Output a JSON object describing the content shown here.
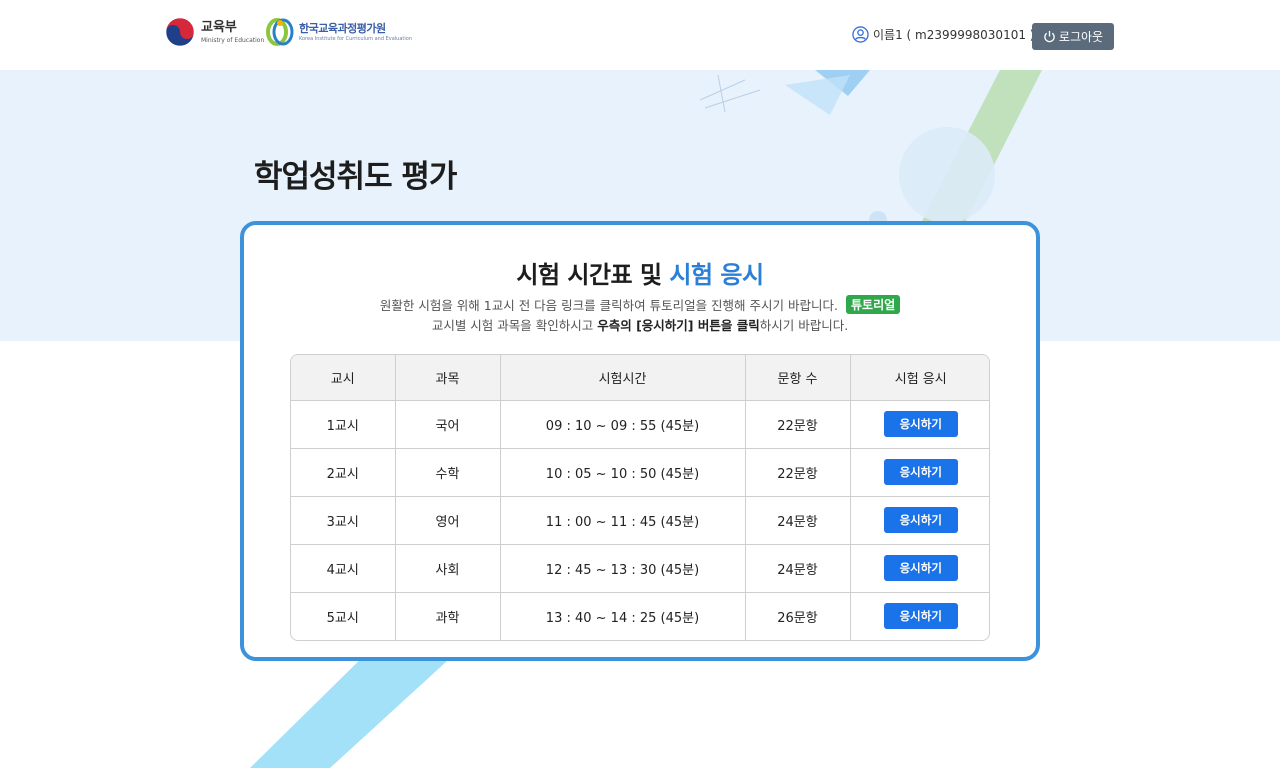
{
  "header": {
    "moe_name": "교육부",
    "moe_sub": "Ministry of Education",
    "kice_name": "한국교육과정평가원",
    "kice_sub": "Korea Institute for Curriculum and Evaluation",
    "user_label": "이름1 ( m2399998030101 )",
    "logout_label": "로그아웃"
  },
  "page": {
    "title": "학업성취도 평가"
  },
  "card": {
    "title_plain": "시험 시간표 및 ",
    "title_accent": "시험 응시",
    "desc1": "원활한 시험을 위해 1교시 전 다음 링크를 클릭하여 튜토리얼을 진행해 주시기 바랍니다.",
    "tutorial_label": "튜토리얼",
    "desc2_pre": "교시별 시험 과목을 확인하시고 ",
    "desc2_bold": "우측의 [응시하기] 버튼을 클릭",
    "desc2_post": "하시기 바랍니다."
  },
  "table": {
    "headers": [
      "교시",
      "과목",
      "시험시간",
      "문항 수",
      "시험 응시"
    ],
    "rows": [
      {
        "period": "1교시",
        "subject": "국어",
        "time": "09 : 10 ~ 09 : 55 (45분)",
        "count": "22문항",
        "button": "응시하기"
      },
      {
        "period": "2교시",
        "subject": "수학",
        "time": "10 : 05 ~ 10 : 50 (45분)",
        "count": "22문항",
        "button": "응시하기"
      },
      {
        "period": "3교시",
        "subject": "영어",
        "time": "11 : 00 ~ 11 : 45 (45분)",
        "count": "24문항",
        "button": "응시하기"
      },
      {
        "period": "4교시",
        "subject": "사회",
        "time": "12 : 45 ~ 13 : 30 (45분)",
        "count": "24문항",
        "button": "응시하기"
      },
      {
        "period": "5교시",
        "subject": "과학",
        "time": "13 : 40 ~ 14 : 25 (45분)",
        "count": "26문항",
        "button": "응시하기"
      }
    ]
  },
  "icons": {
    "user": "user-circle-icon",
    "power": "power-icon"
  },
  "colors": {
    "accent": "#2b7fd6",
    "card_border": "#3c93dc",
    "apply_button": "#1a73e8",
    "tutorial_badge": "#2ea84a",
    "logout_button": "#5b6b7c",
    "hero_bg": "#e8f2fc"
  }
}
